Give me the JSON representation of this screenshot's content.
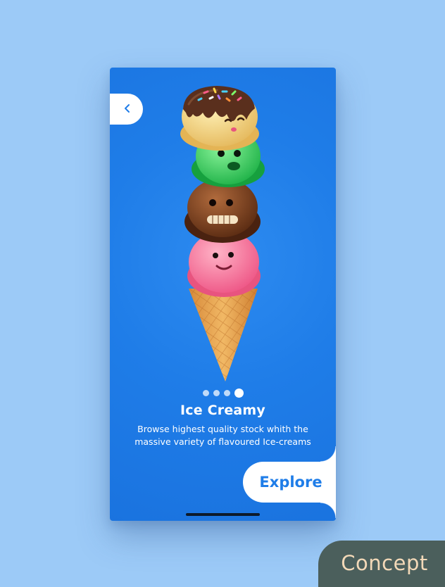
{
  "screen": {
    "back_icon": "chevron-left-icon",
    "illustration": {
      "description_icon": "ice-cream-cone-icon",
      "scoop_colors": [
        "#f4d58a",
        "#3fd760",
        "#7a3e1f",
        "#f4789a"
      ],
      "topping_color": "#5a2f1d",
      "cone_color": "#e7a04d"
    },
    "pager": {
      "total": 4,
      "active_index": 3
    },
    "title": "Ice Creamy",
    "description": "Browse highest quality stock whith the massive variety of flavoured Ice-creams",
    "cta_label": "Explore"
  },
  "badge": {
    "label": "Concept"
  },
  "colors": {
    "background": "#9ccaf7",
    "card": "#1f7de8",
    "accent": "#1f7de8",
    "badge": "#4b5f5c",
    "badge_text": "#f3d9b8"
  }
}
